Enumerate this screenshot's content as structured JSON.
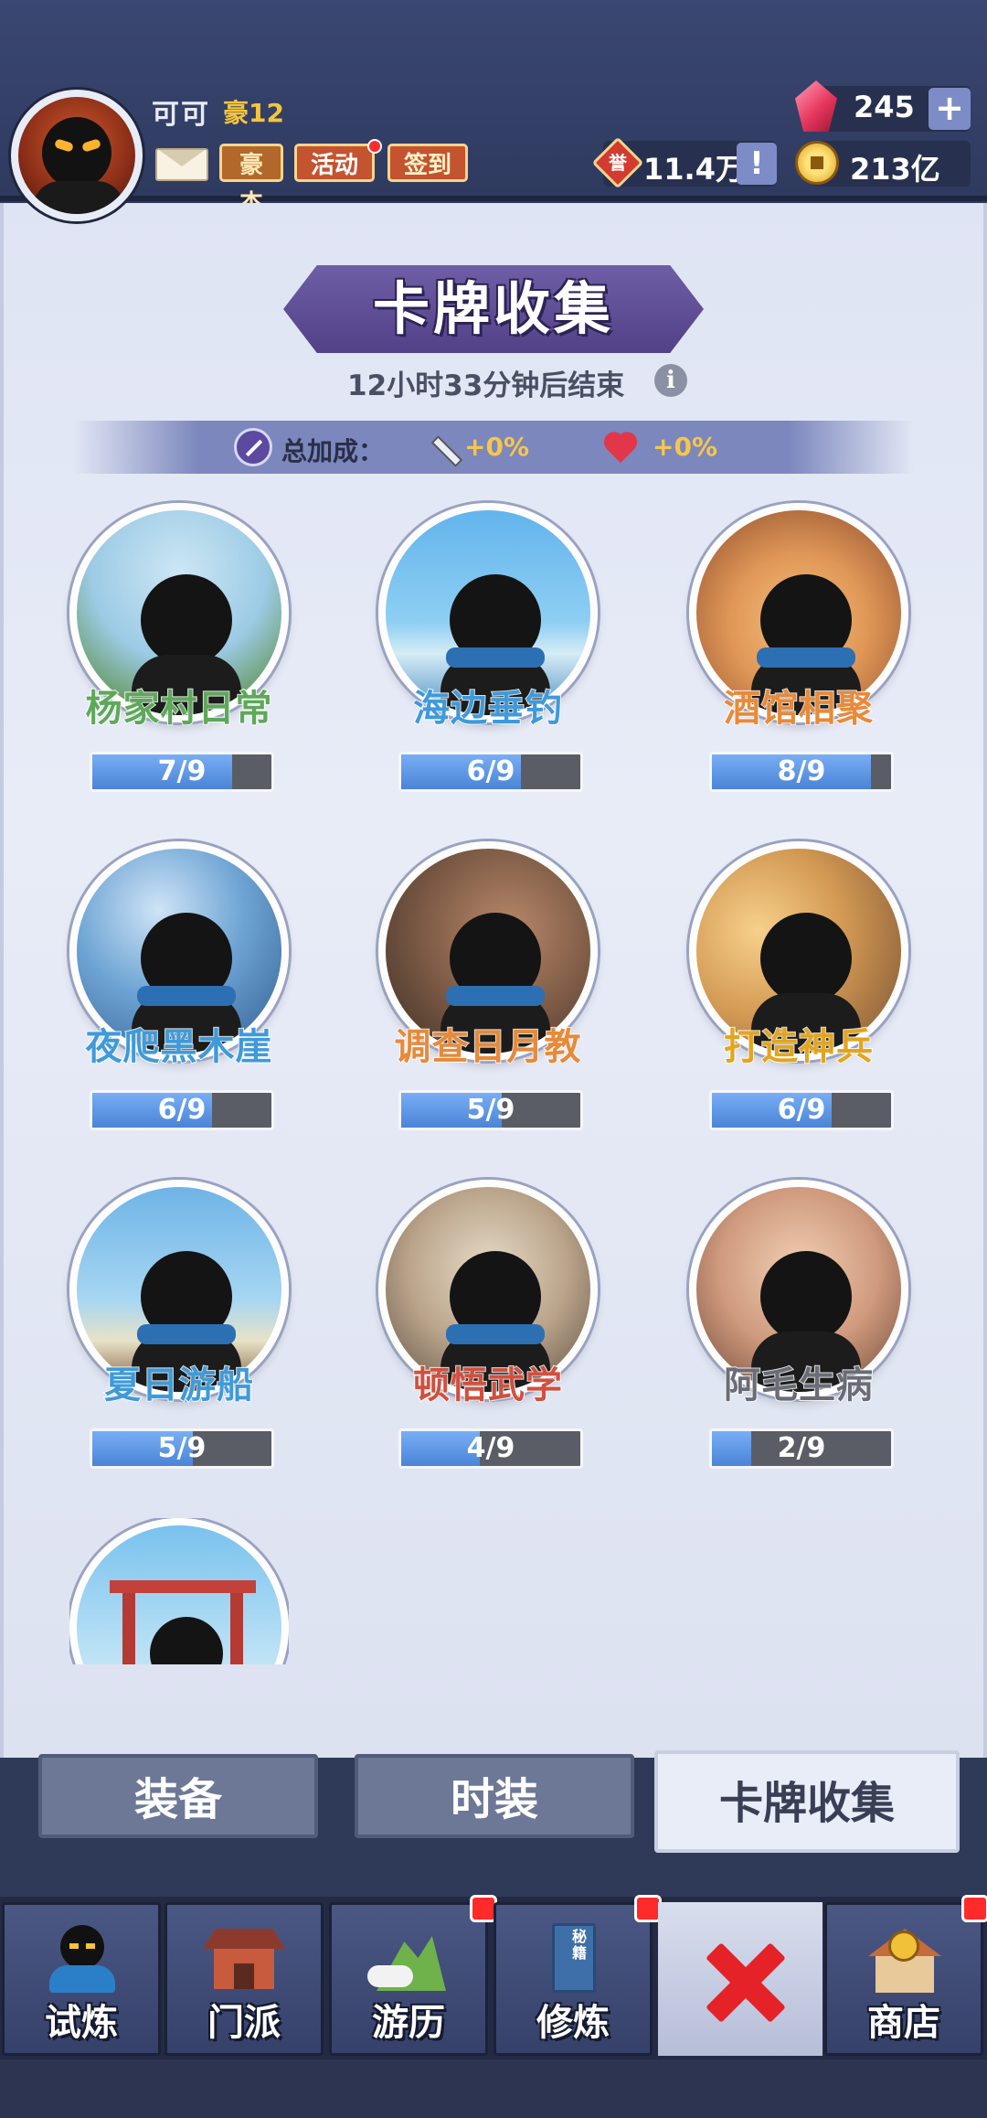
{
  "player": {
    "name": "可可",
    "vip_label": "豪12"
  },
  "top_buttons": {
    "haojie": "豪杰",
    "huodong": "活动",
    "qiandao": "签到"
  },
  "currency": {
    "gems": "245",
    "gems_plus": "+",
    "reputation_icon_text": "誉",
    "reputation": "11.4万",
    "reputation_info": "!",
    "coins": "213亿"
  },
  "header": {
    "title": "卡牌收集",
    "countdown": "12小时33分钟后结束",
    "info_icon": "i"
  },
  "bonus": {
    "label": "总加成：",
    "attack": "+0%",
    "health": "+0%"
  },
  "cards": [
    {
      "name": "杨家村日常",
      "progress_text": "7/9",
      "progress": 0.78
    },
    {
      "name": "海边垂钓",
      "progress_text": "6/9",
      "progress": 0.67
    },
    {
      "name": "酒馆相聚",
      "progress_text": "8/9",
      "progress": 0.89
    },
    {
      "name": "夜爬黑木崖",
      "progress_text": "6/9",
      "progress": 0.67
    },
    {
      "name": "调查日月教",
      "progress_text": "5/9",
      "progress": 0.56
    },
    {
      "name": "打造神兵",
      "progress_text": "6/9",
      "progress": 0.67
    },
    {
      "name": "夏日游船",
      "progress_text": "5/9",
      "progress": 0.56
    },
    {
      "name": "顿悟武学",
      "progress_text": "4/9",
      "progress": 0.44
    },
    {
      "name": "阿毛生病",
      "progress_text": "2/9",
      "progress": 0.22
    },
    {
      "name": "",
      "progress_text": "",
      "progress": 0
    }
  ],
  "tabs": {
    "equip": "装备",
    "fashion": "时装",
    "cards": "卡牌收集"
  },
  "nav": {
    "trial": "试炼",
    "sect": "门派",
    "travel": "游历",
    "cultivate": "修炼",
    "shop": "商店",
    "cultivate_book_text": "秘籍"
  },
  "colors": {
    "accent_purple": "#524187",
    "progress_fill": "#4a84d6",
    "close_red": "#e52228"
  }
}
